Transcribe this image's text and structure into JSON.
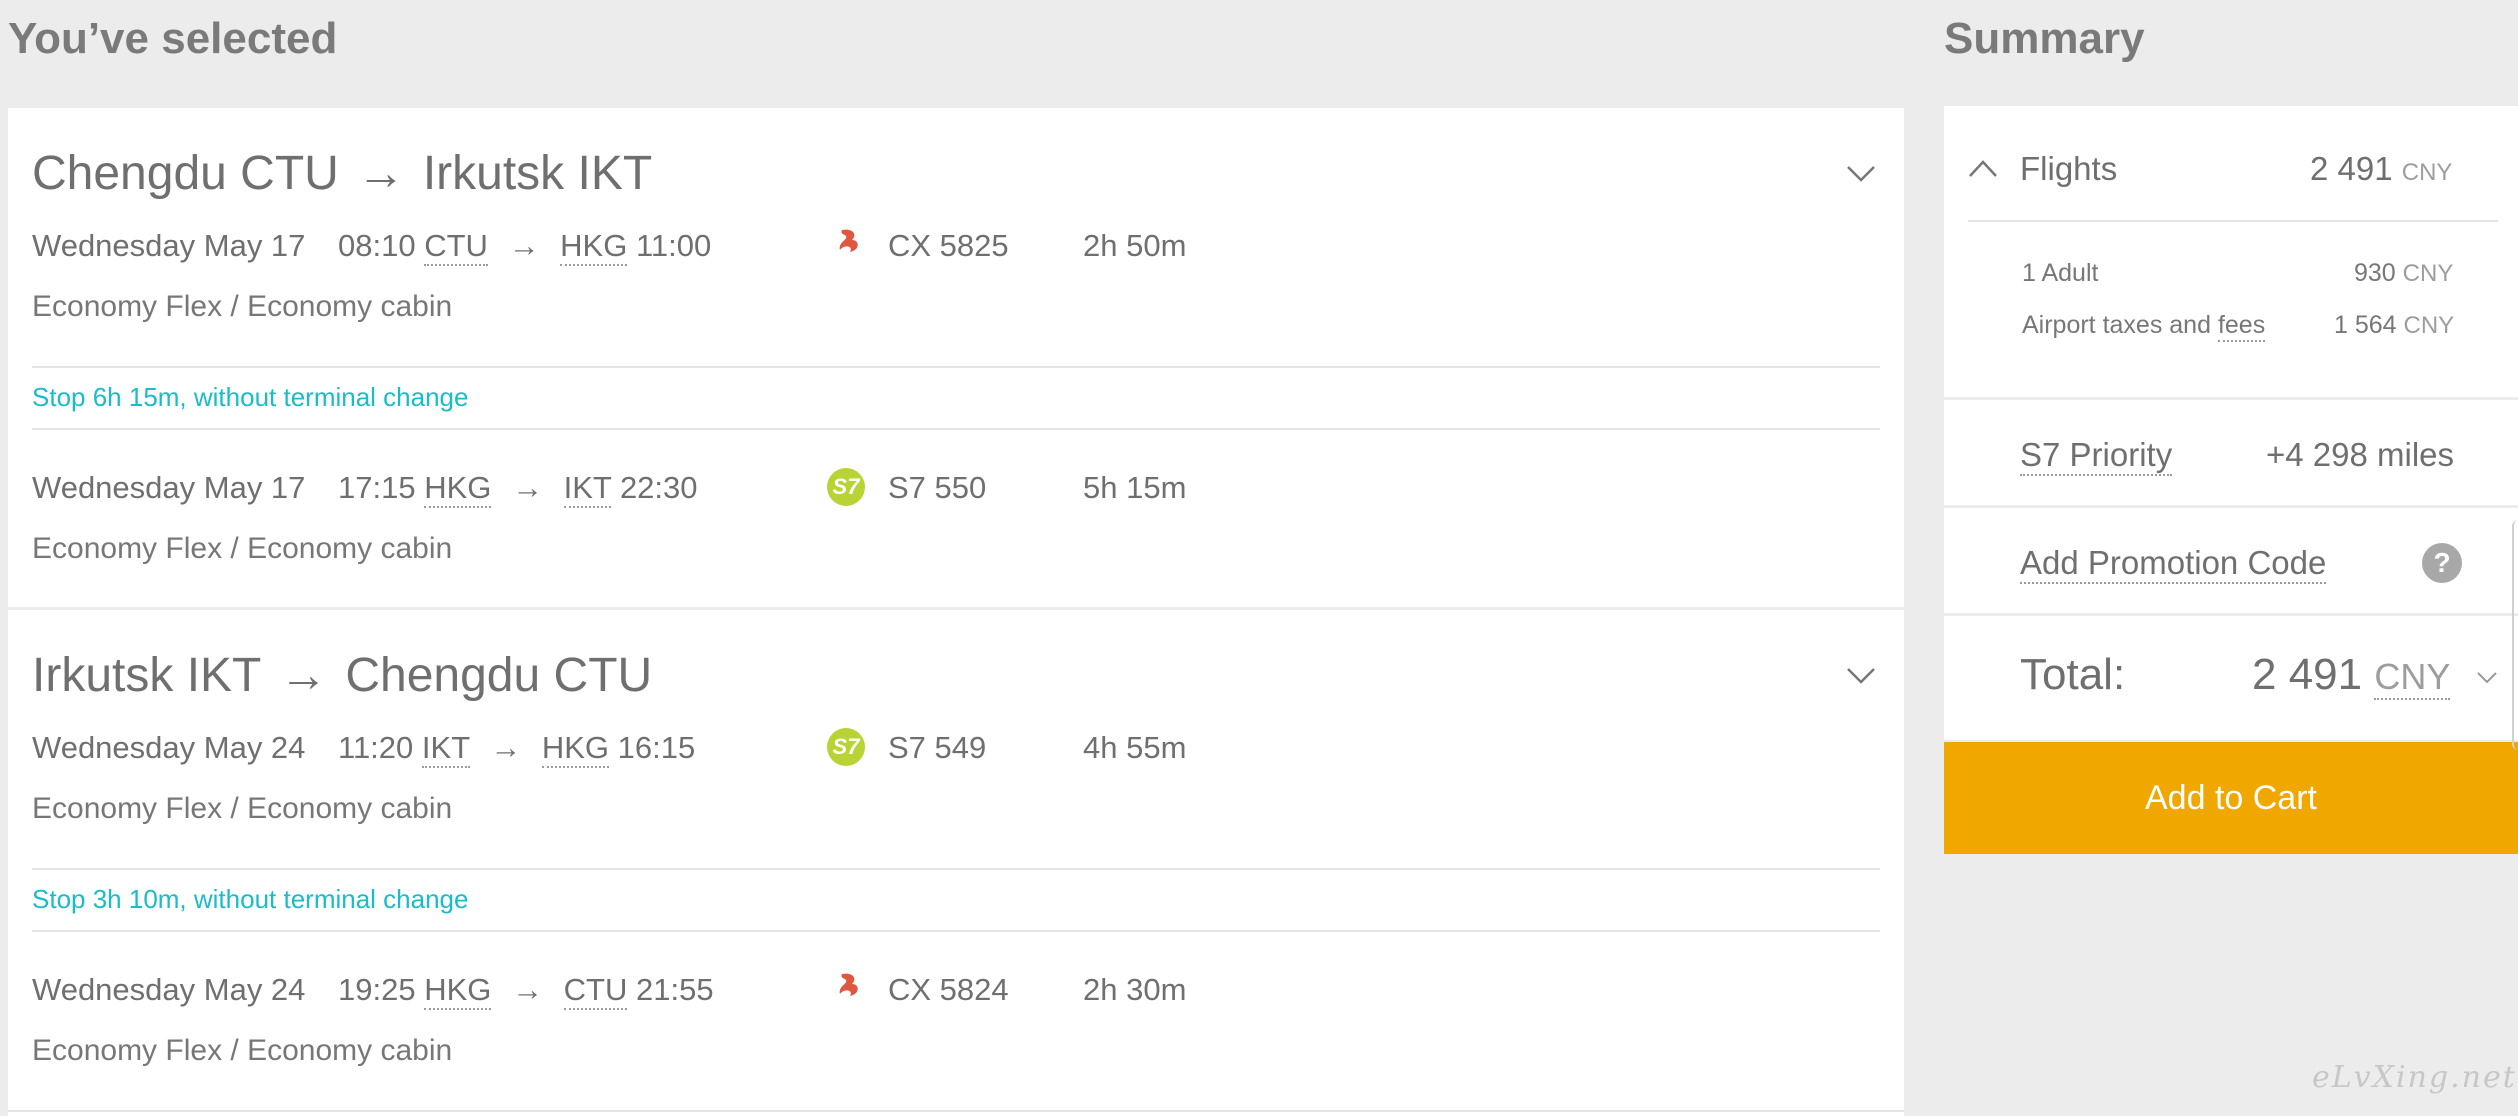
{
  "selected_heading": "You’ve selected",
  "summary_heading": "Summary",
  "routes": [
    {
      "title_from": "Chengdu CTU",
      "title_to": "Irkutsk IKT",
      "segments": [
        {
          "date": "Wednesday May 17",
          "dep_time": "08:10",
          "dep_code": "CTU",
          "arr_code": "HKG",
          "arr_time": "11:00",
          "airline_icon": "cathay-logo-icon",
          "flight": "CX 5825",
          "duration": "2h 50m",
          "cabin": "Economy Flex / Economy cabin"
        },
        {
          "date": "Wednesday May 17",
          "dep_time": "17:15",
          "dep_code": "HKG",
          "arr_code": "IKT",
          "arr_time": "22:30",
          "airline_icon": "s7-logo-icon",
          "logo_text": "S7",
          "flight": "S7 550",
          "duration": "5h 15m",
          "cabin": "Economy Flex / Economy cabin"
        }
      ],
      "stop": "Stop 6h 15m, without terminal change"
    },
    {
      "title_from": "Irkutsk IKT",
      "title_to": "Chengdu CTU",
      "segments": [
        {
          "date": "Wednesday May 24",
          "dep_time": "11:20",
          "dep_code": "IKT",
          "arr_code": "HKG",
          "arr_time": "16:15",
          "airline_icon": "s7-logo-icon",
          "logo_text": "S7",
          "flight": "S7 549",
          "duration": "4h 55m",
          "cabin": "Economy Flex / Economy cabin"
        },
        {
          "date": "Wednesday May 24",
          "dep_time": "19:25",
          "dep_code": "HKG",
          "arr_code": "CTU",
          "arr_time": "21:55",
          "airline_icon": "cathay-logo-icon",
          "flight": "CX 5824",
          "duration": "2h 30m",
          "cabin": "Economy Flex / Economy cabin"
        }
      ],
      "stop": "Stop 3h 10m, without terminal change"
    }
  ],
  "summary": {
    "flights_label": "Flights",
    "flights_amount": "2 491",
    "currency": "CNY",
    "adult_label": "1 Adult",
    "adult_amount": "930",
    "taxes_label": "Airport taxes and",
    "taxes_link": "fees",
    "taxes_amount": "1 564",
    "priority_label": "S7 Priority",
    "priority_miles": "+4 298 miles",
    "promo_label": "Add Promotion Code",
    "help_symbol": "?",
    "total_label": "Total:",
    "total_amount": "2 491",
    "add_to_cart": "Add to Cart"
  },
  "watermark": "eLvXing.net",
  "colors": {
    "accent_orange": "#f0a800",
    "stop_teal": "#19bdc9",
    "s7_green": "#b8d334",
    "cathay_red": "#e0573f"
  }
}
